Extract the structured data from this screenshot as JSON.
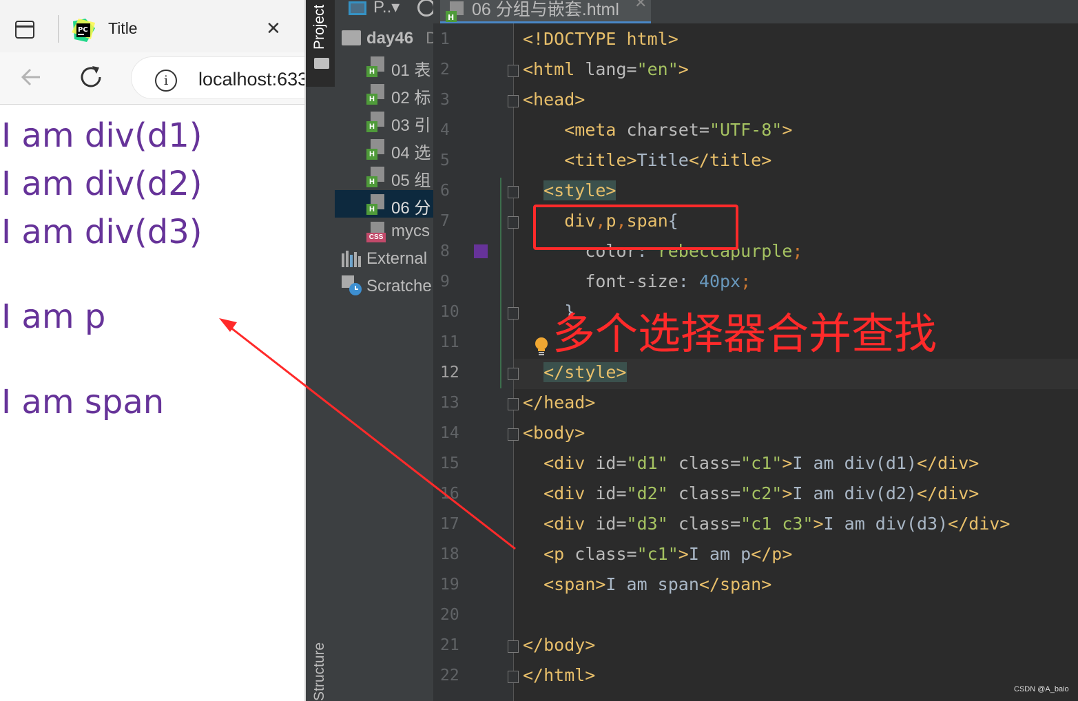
{
  "browser": {
    "tab_title": "Title",
    "tab_close_glyph": "✕",
    "url": "localhost:633",
    "rendered_lines": [
      "I am div(d1)",
      "I am div(d2)",
      "I am div(d3)",
      "I am p",
      "I am span"
    ],
    "text_color": "#663399",
    "icons": [
      "sidebar-toggle-icon",
      "pycharm-favicon-icon",
      "close-icon",
      "back-arrow-icon",
      "reload-icon",
      "info-icon"
    ]
  },
  "ide": {
    "strip_top_label": "Project",
    "strip_bottom_label": "Structure",
    "project_header_label": "P..",
    "project_header_caret": "▾",
    "tree": {
      "root": "day46",
      "root_suffix": "D",
      "files": [
        {
          "label": "01 表",
          "kind": "html"
        },
        {
          "label": "02 标",
          "kind": "html"
        },
        {
          "label": "03 引",
          "kind": "html"
        },
        {
          "label": "04 选",
          "kind": "html"
        },
        {
          "label": "05 组",
          "kind": "html"
        },
        {
          "label": "06 分",
          "kind": "html",
          "selected": true
        },
        {
          "label": "mycs",
          "kind": "css"
        }
      ],
      "external": "External",
      "scratches": "Scratche"
    },
    "editor_tab": "06 分组与嵌套.html",
    "editor_tab_close": "✕",
    "current_line": 12,
    "line_numbers": [
      "1",
      "2",
      "3",
      "4",
      "5",
      "6",
      "7",
      "8",
      "9",
      "10",
      "11",
      "12",
      "13",
      "14",
      "15",
      "16",
      "17",
      "18",
      "19",
      "20",
      "21",
      "22"
    ],
    "code": {
      "l1": {
        "tag": "<!DOCTYPE html>"
      },
      "l2": {
        "open": "<html",
        "attr": " lang=",
        "val": "\"en\"",
        "close": ">"
      },
      "l3": {
        "tag": "<head>"
      },
      "l4": {
        "open": "<meta",
        "attr": " charset=",
        "val": "\"UTF-8\"",
        "close": ">"
      },
      "l5": {
        "open": "<title>",
        "text": "Title",
        "close": "</title>"
      },
      "l6": {
        "tag": "<style>"
      },
      "l7": {
        "sel1": "div",
        "c1": ",",
        "sel2": "p",
        "c2": ",",
        "sel3": "span",
        "brace": "{"
      },
      "l8": {
        "prop": "color",
        "colon": ": ",
        "value": "rebeccapurple",
        "semi": ";"
      },
      "l9": {
        "prop": "font-size",
        "colon": ": ",
        "num": "40px",
        "semi": ";"
      },
      "l10": {
        "brace": "}"
      },
      "l12": {
        "tag": "</style>"
      },
      "l13": {
        "tag": "</head>"
      },
      "l14": {
        "tag": "<body>"
      },
      "l15": {
        "open": "<div",
        "a1": " id=",
        "v1": "\"d1\"",
        "a2": " class=",
        "v2": "\"c1\"",
        "close": ">",
        "text": "I am div(d1)",
        "end": "</div>"
      },
      "l16": {
        "open": "<div",
        "a1": " id=",
        "v1": "\"d2\"",
        "a2": " class=",
        "v2": "\"c2\"",
        "close": ">",
        "text": "I am div(d2)",
        "end": "</div>"
      },
      "l17": {
        "open": "<div",
        "a1": " id=",
        "v1": "\"d3\"",
        "a2": " class=",
        "v2": "\"c1 c3\"",
        "close": ">",
        "text": "I am div(d3)",
        "end": "</div>"
      },
      "l18": {
        "open": "<p",
        "a1": " class=",
        "v1": "\"c1\"",
        "close": ">",
        "text": "I am p",
        "end": "</p>"
      },
      "l19": {
        "open": "<span>",
        "text": "I am span",
        "end": "</span>"
      },
      "l21": {
        "tag": "</body>"
      },
      "l22": {
        "tag": "</html>"
      }
    },
    "swatch_color": "#663399"
  },
  "annotation": {
    "text": "多个选择器合并查找",
    "color": "#ff2a2a"
  },
  "watermark": "CSDN @A_baio"
}
